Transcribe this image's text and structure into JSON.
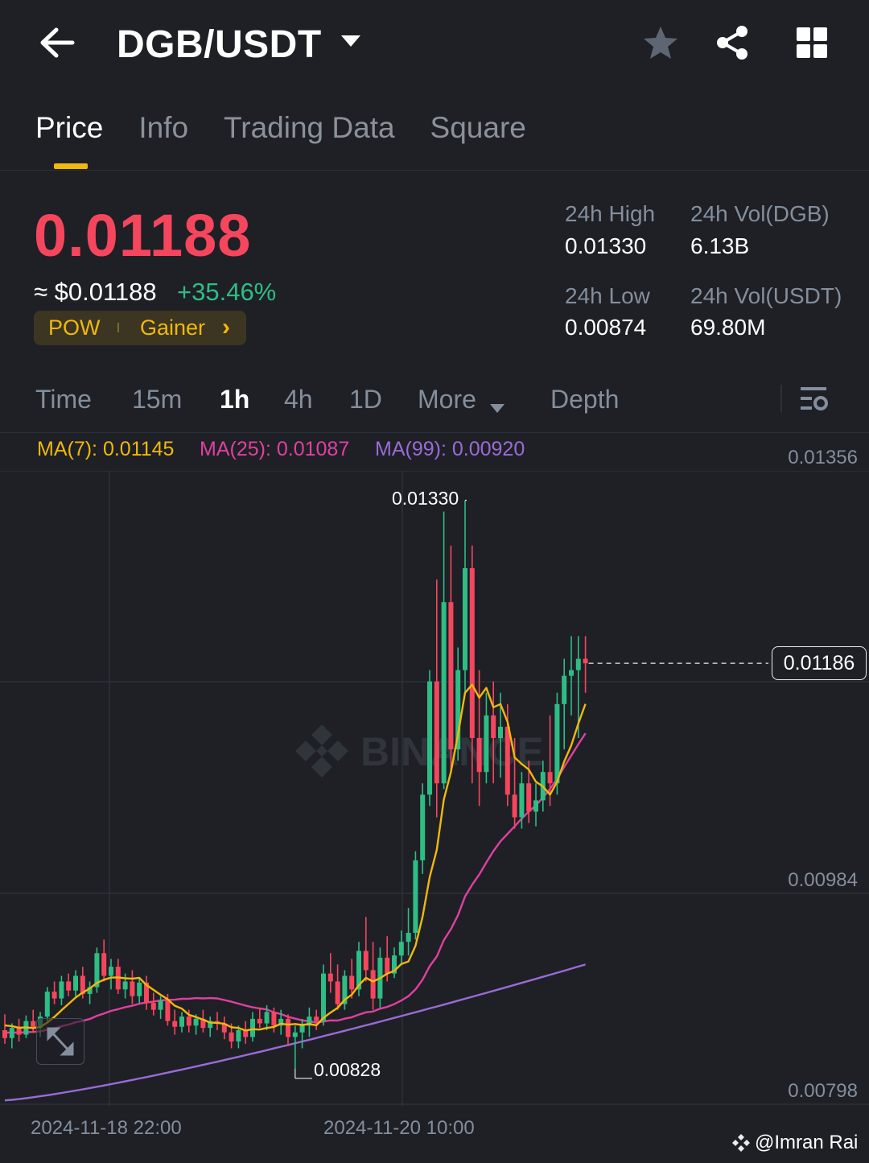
{
  "header": {
    "pair": "DGB/USDT",
    "back_icon": "arrow-left-icon",
    "dropdown_icon": "caret-down-icon",
    "favorite_icon": "star-icon",
    "share_icon": "share-icon",
    "grid_icon": "grid-icon"
  },
  "tabs": [
    {
      "label": "Price",
      "active": true
    },
    {
      "label": "Info",
      "active": false
    },
    {
      "label": "Trading Data",
      "active": false
    },
    {
      "label": "Square",
      "active": false
    }
  ],
  "price": {
    "last": "0.01188",
    "fiat": "≈ $0.01188",
    "change_pct": "+35.46%",
    "tags": {
      "pow": "POW",
      "gainer": "Gainer",
      "chevron": "›"
    }
  },
  "stats": {
    "high_label": "24h High",
    "high_value": "0.01330",
    "low_label": "24h Low",
    "low_value": "0.00874",
    "vol_base_label": "24h Vol(DGB)",
    "vol_base_value": "6.13B",
    "vol_quote_label": "24h Vol(USDT)",
    "vol_quote_value": "69.80M"
  },
  "intervals": {
    "time": "Time",
    "m15": "15m",
    "h1": "1h",
    "h4": "4h",
    "d1": "1D",
    "more": "More",
    "depth": "Depth",
    "active": "1h"
  },
  "indicators": {
    "ma7": "MA(7): 0.01145",
    "ma25": "MA(25): 0.01087",
    "ma99": "MA(99): 0.00920"
  },
  "axis": {
    "y_top": "0.01356",
    "y_mid": "0.00984",
    "y_bottom": "0.00798",
    "current_price_tag": "0.01186",
    "high_marker": "0.01330",
    "low_marker": "0.00828",
    "x_label_1": "2024-11-18 22:00",
    "x_label_2": "2024-11-20 10:00"
  },
  "watermark": {
    "brand": "BINANCE",
    "credit": "@Imran Rai"
  },
  "colors": {
    "up": "#2ebd85",
    "down": "#f6465d",
    "ma7": "#f0b90b",
    "ma25": "#e040a0",
    "ma99": "#9b6bd6",
    "accent": "#f0b90b"
  },
  "chart_data": {
    "type": "candlestick",
    "interval": "1h",
    "y_range": [
      0.0078,
      0.0138
    ],
    "candles": [
      {
        "o": 0.00862,
        "h": 0.00876,
        "l": 0.0085,
        "c": 0.00855
      },
      {
        "o": 0.00855,
        "h": 0.00868,
        "l": 0.00846,
        "c": 0.00864
      },
      {
        "o": 0.00864,
        "h": 0.00872,
        "l": 0.00852,
        "c": 0.00858
      },
      {
        "o": 0.00858,
        "h": 0.00875,
        "l": 0.00855,
        "c": 0.0087
      },
      {
        "o": 0.0087,
        "h": 0.0088,
        "l": 0.0086,
        "c": 0.00864
      },
      {
        "o": 0.00864,
        "h": 0.00878,
        "l": 0.00856,
        "c": 0.00874
      },
      {
        "o": 0.00874,
        "h": 0.009,
        "l": 0.00868,
        "c": 0.00896
      },
      {
        "o": 0.00896,
        "h": 0.00905,
        "l": 0.00885,
        "c": 0.0089
      },
      {
        "o": 0.0089,
        "h": 0.0091,
        "l": 0.00884,
        "c": 0.00905
      },
      {
        "o": 0.00905,
        "h": 0.00912,
        "l": 0.00892,
        "c": 0.00897
      },
      {
        "o": 0.00897,
        "h": 0.00915,
        "l": 0.00892,
        "c": 0.0091
      },
      {
        "o": 0.0091,
        "h": 0.00918,
        "l": 0.0089,
        "c": 0.00894
      },
      {
        "o": 0.00894,
        "h": 0.00905,
        "l": 0.00885,
        "c": 0.009
      },
      {
        "o": 0.009,
        "h": 0.00935,
        "l": 0.00895,
        "c": 0.0093
      },
      {
        "o": 0.0093,
        "h": 0.00942,
        "l": 0.00905,
        "c": 0.0091
      },
      {
        "o": 0.0091,
        "h": 0.00925,
        "l": 0.00898,
        "c": 0.00918
      },
      {
        "o": 0.00918,
        "h": 0.00925,
        "l": 0.00894,
        "c": 0.00898
      },
      {
        "o": 0.00898,
        "h": 0.00912,
        "l": 0.0089,
        "c": 0.00905
      },
      {
        "o": 0.00905,
        "h": 0.00915,
        "l": 0.00885,
        "c": 0.00892
      },
      {
        "o": 0.00892,
        "h": 0.00908,
        "l": 0.00886,
        "c": 0.00904
      },
      {
        "o": 0.00904,
        "h": 0.0091,
        "l": 0.0088,
        "c": 0.00886
      },
      {
        "o": 0.00886,
        "h": 0.00895,
        "l": 0.00875,
        "c": 0.0088
      },
      {
        "o": 0.0088,
        "h": 0.00892,
        "l": 0.00872,
        "c": 0.00888
      },
      {
        "o": 0.00888,
        "h": 0.00894,
        "l": 0.00866,
        "c": 0.0087
      },
      {
        "o": 0.0087,
        "h": 0.0088,
        "l": 0.00858,
        "c": 0.00865
      },
      {
        "o": 0.00865,
        "h": 0.00878,
        "l": 0.0086,
        "c": 0.00874
      },
      {
        "o": 0.00874,
        "h": 0.0088,
        "l": 0.0086,
        "c": 0.00866
      },
      {
        "o": 0.00866,
        "h": 0.00876,
        "l": 0.00858,
        "c": 0.00872
      },
      {
        "o": 0.00872,
        "h": 0.0088,
        "l": 0.0086,
        "c": 0.00864
      },
      {
        "o": 0.00864,
        "h": 0.00874,
        "l": 0.00856,
        "c": 0.0087
      },
      {
        "o": 0.0087,
        "h": 0.00878,
        "l": 0.00862,
        "c": 0.00868
      },
      {
        "o": 0.00868,
        "h": 0.00874,
        "l": 0.00854,
        "c": 0.0086
      },
      {
        "o": 0.0086,
        "h": 0.00868,
        "l": 0.00846,
        "c": 0.00852
      },
      {
        "o": 0.00852,
        "h": 0.00866,
        "l": 0.00846,
        "c": 0.00862
      },
      {
        "o": 0.00862,
        "h": 0.0087,
        "l": 0.0085,
        "c": 0.00856
      },
      {
        "o": 0.00856,
        "h": 0.00878,
        "l": 0.00852,
        "c": 0.00872
      },
      {
        "o": 0.00872,
        "h": 0.00882,
        "l": 0.00864,
        "c": 0.00868
      },
      {
        "o": 0.00868,
        "h": 0.00884,
        "l": 0.00862,
        "c": 0.00878
      },
      {
        "o": 0.00878,
        "h": 0.00882,
        "l": 0.0086,
        "c": 0.00866
      },
      {
        "o": 0.00866,
        "h": 0.0088,
        "l": 0.00858,
        "c": 0.00872
      },
      {
        "o": 0.00872,
        "h": 0.00876,
        "l": 0.00848,
        "c": 0.00856
      },
      {
        "o": 0.00856,
        "h": 0.00866,
        "l": 0.00828,
        "c": 0.0086
      },
      {
        "o": 0.0086,
        "h": 0.00872,
        "l": 0.00846,
        "c": 0.00866
      },
      {
        "o": 0.00866,
        "h": 0.00882,
        "l": 0.00856,
        "c": 0.00874
      },
      {
        "o": 0.00874,
        "h": 0.0088,
        "l": 0.00862,
        "c": 0.0087
      },
      {
        "o": 0.0087,
        "h": 0.0092,
        "l": 0.00866,
        "c": 0.00912
      },
      {
        "o": 0.00912,
        "h": 0.0093,
        "l": 0.00895,
        "c": 0.00905
      },
      {
        "o": 0.00905,
        "h": 0.0092,
        "l": 0.0088,
        "c": 0.00885
      },
      {
        "o": 0.00885,
        "h": 0.00915,
        "l": 0.0088,
        "c": 0.0091
      },
      {
        "o": 0.0091,
        "h": 0.00925,
        "l": 0.0089,
        "c": 0.00898
      },
      {
        "o": 0.00898,
        "h": 0.0094,
        "l": 0.00892,
        "c": 0.00932
      },
      {
        "o": 0.00932,
        "h": 0.00962,
        "l": 0.00905,
        "c": 0.00915
      },
      {
        "o": 0.00915,
        "h": 0.0094,
        "l": 0.0088,
        "c": 0.0089
      },
      {
        "o": 0.0089,
        "h": 0.00935,
        "l": 0.00882,
        "c": 0.00926
      },
      {
        "o": 0.00926,
        "h": 0.00945,
        "l": 0.00905,
        "c": 0.00912
      },
      {
        "o": 0.00912,
        "h": 0.00935,
        "l": 0.00908,
        "c": 0.00928
      },
      {
        "o": 0.00928,
        "h": 0.0095,
        "l": 0.0092,
        "c": 0.0094
      },
      {
        "o": 0.0094,
        "h": 0.0097,
        "l": 0.00928,
        "c": 0.00948
      },
      {
        "o": 0.00948,
        "h": 0.0102,
        "l": 0.00942,
        "c": 0.01012
      },
      {
        "o": 0.01012,
        "h": 0.0108,
        "l": 0.01,
        "c": 0.0107
      },
      {
        "o": 0.0107,
        "h": 0.0118,
        "l": 0.0106,
        "c": 0.0117
      },
      {
        "o": 0.0117,
        "h": 0.0126,
        "l": 0.0105,
        "c": 0.0108
      },
      {
        "o": 0.0108,
        "h": 0.0132,
        "l": 0.01075,
        "c": 0.0124
      },
      {
        "o": 0.0124,
        "h": 0.0129,
        "l": 0.0109,
        "c": 0.0111
      },
      {
        "o": 0.0111,
        "h": 0.012,
        "l": 0.011,
        "c": 0.0118
      },
      {
        "o": 0.0118,
        "h": 0.0133,
        "l": 0.0116,
        "c": 0.0127
      },
      {
        "o": 0.0127,
        "h": 0.0129,
        "l": 0.0108,
        "c": 0.0112
      },
      {
        "o": 0.0112,
        "h": 0.0118,
        "l": 0.0106,
        "c": 0.0109
      },
      {
        "o": 0.0109,
        "h": 0.0116,
        "l": 0.0108,
        "c": 0.0114
      },
      {
        "o": 0.0114,
        "h": 0.0117,
        "l": 0.0108,
        "c": 0.0112
      },
      {
        "o": 0.0112,
        "h": 0.0116,
        "l": 0.01085,
        "c": 0.0113
      },
      {
        "o": 0.0113,
        "h": 0.0115,
        "l": 0.0106,
        "c": 0.0107
      },
      {
        "o": 0.0107,
        "h": 0.0112,
        "l": 0.0104,
        "c": 0.0105
      },
      {
        "o": 0.0105,
        "h": 0.0109,
        "l": 0.0104,
        "c": 0.0108
      },
      {
        "o": 0.0108,
        "h": 0.011,
        "l": 0.01045,
        "c": 0.01055
      },
      {
        "o": 0.01055,
        "h": 0.0108,
        "l": 0.01042,
        "c": 0.01065
      },
      {
        "o": 0.01065,
        "h": 0.011,
        "l": 0.01055,
        "c": 0.0109
      },
      {
        "o": 0.0109,
        "h": 0.0114,
        "l": 0.0106,
        "c": 0.0108
      },
      {
        "o": 0.0108,
        "h": 0.0116,
        "l": 0.0107,
        "c": 0.0115
      },
      {
        "o": 0.0115,
        "h": 0.0119,
        "l": 0.0111,
        "c": 0.01175
      },
      {
        "o": 0.01175,
        "h": 0.0121,
        "l": 0.0114,
        "c": 0.0118
      },
      {
        "o": 0.0118,
        "h": 0.0121,
        "l": 0.0112,
        "c": 0.0119
      },
      {
        "o": 0.0119,
        "h": 0.0121,
        "l": 0.0116,
        "c": 0.01186
      }
    ],
    "ma7_start": 0.00868,
    "ma25_start": 0.0086,
    "ma99_start": 0.008,
    "ma99_end": 0.0092
  }
}
